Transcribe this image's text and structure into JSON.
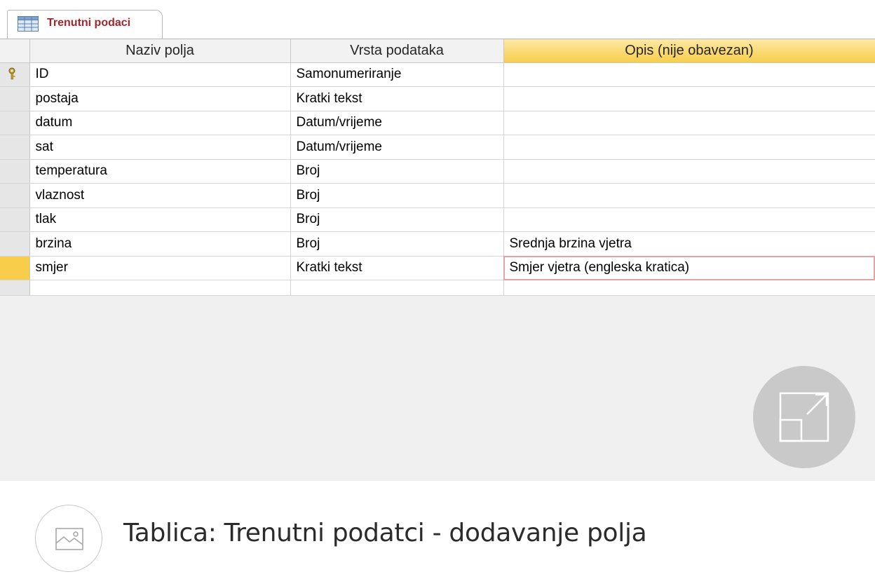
{
  "tab": {
    "label": "Trenutni podaci",
    "icon": "table-icon"
  },
  "columns": {
    "name": "Naziv polja",
    "type": "Vrsta podataka",
    "description": "Opis (nije obavezan)"
  },
  "rows": [
    {
      "name": "ID",
      "type": "Samonumeriranje",
      "description": "",
      "key": true
    },
    {
      "name": "postaja",
      "type": "Kratki tekst",
      "description": ""
    },
    {
      "name": "datum",
      "type": "Datum/vrijeme",
      "description": ""
    },
    {
      "name": "sat",
      "type": "Datum/vrijeme",
      "description": ""
    },
    {
      "name": "temperatura",
      "type": "Broj",
      "description": ""
    },
    {
      "name": "vlaznost",
      "type": "Broj",
      "description": ""
    },
    {
      "name": "tlak",
      "type": "Broj",
      "description": ""
    },
    {
      "name": "brzina",
      "type": "Broj",
      "description": "Srednja brzina vjetra"
    },
    {
      "name": "smjer",
      "type": "Kratki tekst",
      "description": "Smjer vjetra (engleska kratica)",
      "current": true
    }
  ],
  "expand_button": {
    "icon": "expand-icon"
  },
  "caption": {
    "icon": "image-icon",
    "text": "Tablica: Trenutni podatci - dodavanje polja"
  },
  "colors": {
    "tab_label": "#a4262c",
    "active_header": "#f8cd4a",
    "current_row_selector": "#f8cd4a",
    "active_cell_outline": "#e8a0a4"
  }
}
